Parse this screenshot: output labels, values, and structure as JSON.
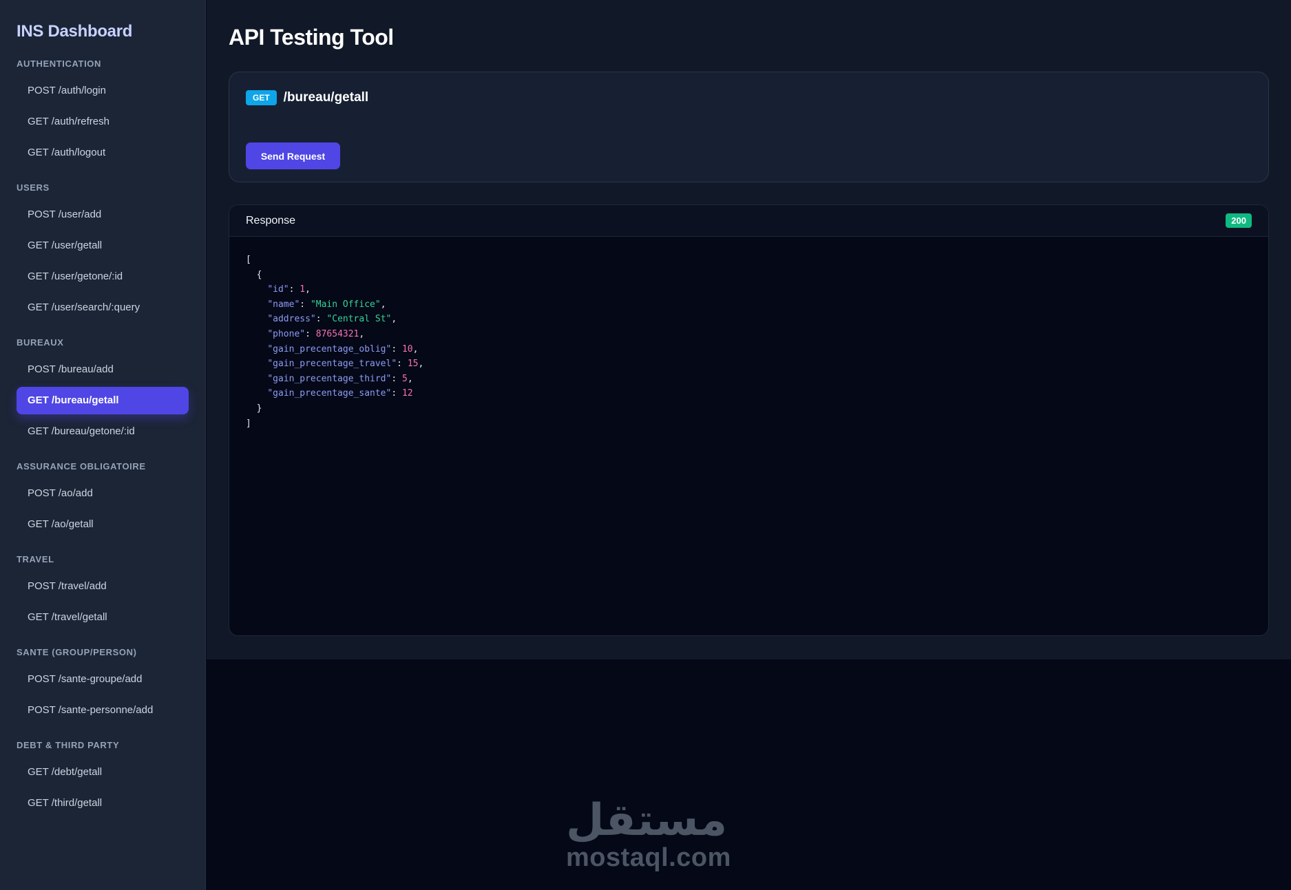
{
  "sidebar": {
    "brand": "INS Dashboard",
    "sections": [
      {
        "title": "AUTHENTICATION",
        "items": [
          "POST /auth/login",
          "GET /auth/refresh",
          "GET /auth/logout"
        ]
      },
      {
        "title": "USERS",
        "items": [
          "POST /user/add",
          "GET /user/getall",
          "GET /user/getone/:id",
          "GET /user/search/:query"
        ]
      },
      {
        "title": "BUREAUX",
        "items": [
          "POST /bureau/add",
          "GET /bureau/getall",
          "GET /bureau/getone/:id"
        ]
      },
      {
        "title": "ASSURANCE OBLIGATOIRE",
        "items": [
          "POST /ao/add",
          "GET /ao/getall"
        ]
      },
      {
        "title": "TRAVEL",
        "items": [
          "POST /travel/add",
          "GET /travel/getall"
        ]
      },
      {
        "title": "SANTE (GROUP/PERSON)",
        "items": [
          "POST /sante-groupe/add",
          "POST /sante-personne/add"
        ]
      },
      {
        "title": "DEBT & THIRD PARTY",
        "items": [
          "GET /debt/getall",
          "GET /third/getall"
        ]
      }
    ],
    "active_item": "GET /bureau/getall"
  },
  "main": {
    "title": "API Testing Tool",
    "request": {
      "method": "GET",
      "path": "/bureau/getall",
      "send_label": "Send Request"
    },
    "response": {
      "title": "Response",
      "status": "200",
      "body": [
        {
          "id": 1,
          "name": "Main Office",
          "address": "Central St",
          "phone": 87654321,
          "gain_precentage_oblig": 10,
          "gain_precentage_travel": 15,
          "gain_precentage_third": 5,
          "gain_precentage_sante": 12
        }
      ]
    }
  },
  "watermark": {
    "arabic": "مستقل",
    "latin": "mostaql.com"
  },
  "colors": {
    "accent": "#4f46e5",
    "method_get": "#0ea5e9",
    "status_ok": "#10b981",
    "json_key": "#8b9cf5",
    "json_string": "#34d399",
    "json_number": "#f472b6"
  }
}
